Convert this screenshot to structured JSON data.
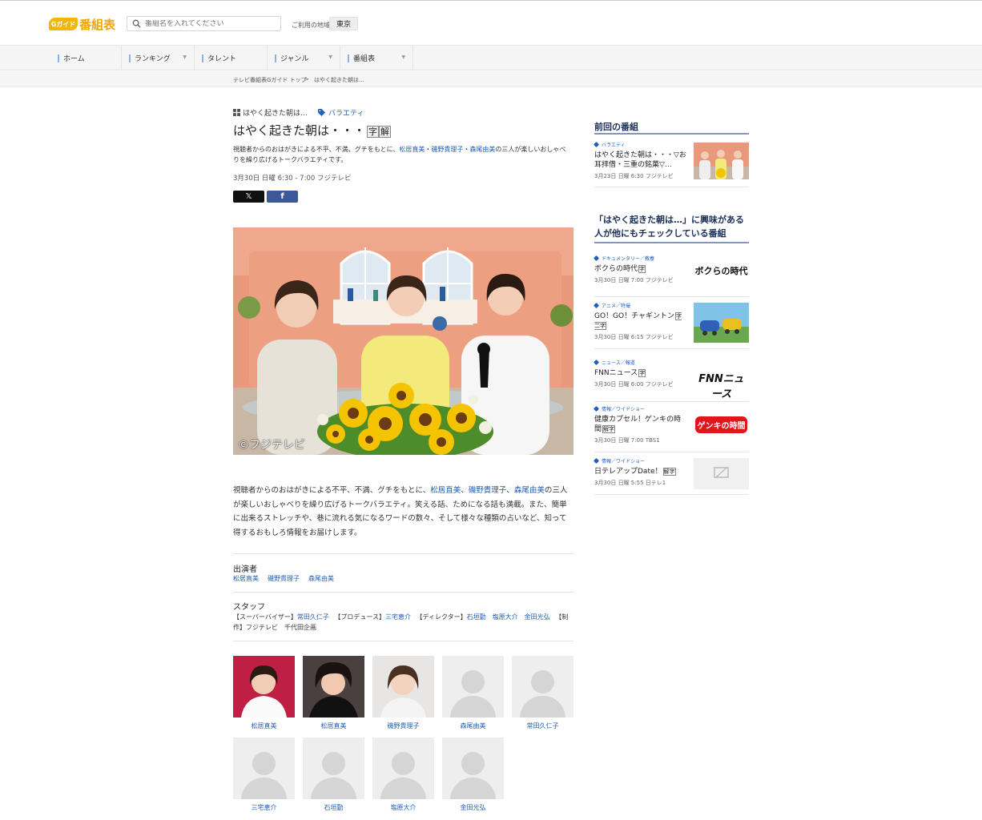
{
  "header": {
    "logo_mark": "Gガイド",
    "logo_text": "番組表",
    "search_placeholder": "番組名を入れてください",
    "region_label": "ご利用の地域",
    "region_value": "東京"
  },
  "nav": {
    "items": [
      {
        "label": "ホーム"
      },
      {
        "label": "ランキング"
      },
      {
        "label": "タレント"
      },
      {
        "label": "ジャンル"
      },
      {
        "label": "番組表"
      }
    ]
  },
  "breadcrumb": {
    "home": "テレビ番組表Gガイド トップ",
    "sep": ">",
    "current": "はやく起きた朝は…"
  },
  "program": {
    "series": "はやく起きた朝は…",
    "genre": "バラエティ",
    "title": "はやく起きた朝は・・・",
    "caption_badge": "字",
    "commentary_badge": "解",
    "summary_pre": "視聴者からのおはがきによる不平、不満、グチをもとに、",
    "summary_cast": [
      "松居直美",
      "磯野貴理子",
      "森尾由美"
    ],
    "summary_post": "の三人が楽しいおしゃべりを繰り広げるトークバラエティです。",
    "airtime": "3月30日 日曜 6:30  - 7:00 フジテレビ",
    "share_x": "𝕏",
    "share_fb": "f",
    "image_credit": "©フジテレビ",
    "desc_pre": "視聴者からのおはがきによる不平、不満、グチをもとに、",
    "desc_post": "の三人が楽しいおしゃべりを繰り広げるトークバラエティ。笑える話、ためになる話も満載。また、簡単に出来るストレッチや、巷に流れる気になるワードの数々、そして様々な種類の占いなど、知って得するおもしろ情報をお届けします。",
    "cast_heading": "出演者",
    "cast": [
      "松居直美",
      "磯野貴理子",
      "森尾由美"
    ],
    "staff_heading": "スタッフ",
    "staff": {
      "supervisor_label": "【スーパーバイザー】",
      "supervisor": "常田久仁子",
      "producer_label": "【プロデュース】",
      "producer": "三宅恵介",
      "director_label": "【ディレクター】",
      "directors": [
        "石垣勤",
        "塩原大介",
        "金田光弘"
      ],
      "production_label": "【制作】",
      "production": "フジテレビ　千代田企画"
    }
  },
  "people": [
    {
      "name": "松居直美",
      "photo": "photo-1"
    },
    {
      "name": "松居直美",
      "photo": "photo-2"
    },
    {
      "name": "磯野貴理子",
      "photo": "photo-3"
    },
    {
      "name": "森尾由美",
      "photo": "placeholder"
    },
    {
      "name": "常田久仁子",
      "photo": "placeholder"
    },
    {
      "name": "三宅恵介",
      "photo": "placeholder"
    },
    {
      "name": "石垣勤",
      "photo": "placeholder"
    },
    {
      "name": "塩原大介",
      "photo": "placeholder"
    },
    {
      "name": "金田光弘",
      "photo": "placeholder"
    }
  ],
  "sidebar": {
    "previous_heading": "前回の番組",
    "previous": {
      "category": "バラエティ",
      "title": "はやく起きた朝は・・・▽お耳拝借・三重の銘菓▽…",
      "time": "3月23日 日曜 6:30 フジテレビ"
    },
    "related_heading": "「はやく起きた朝は…」に興味がある人が他にもチェックしている番組",
    "related": [
      {
        "category": "ドキュメンタリー／教養",
        "title": "ボクらの時代",
        "badges": "字",
        "time": "3月30日 日曜 7:00 フジテレビ",
        "thumb_text": "ボクらの時代"
      },
      {
        "category": "アニメ／特撮",
        "title": "GO！GO！チャギントン",
        "badges": "字二字",
        "time": "3月30日 日曜 6:15 フジテレビ",
        "thumb_text": ""
      },
      {
        "category": "ニュース／報道",
        "title": "FNNニュース",
        "badges": "字",
        "time": "3月30日 日曜 6:00 フジテレビ",
        "thumb_text": "FNNニュース"
      },
      {
        "category": "情報／ワイドショー",
        "title": "健康カプセル！ゲンキの時間",
        "badges": "解字",
        "time": "3月30日 日曜 7:00 TBS1",
        "thumb_text": "ゲンキの時間"
      },
      {
        "category": "情報／ワイドショー",
        "title": "日テレアップDate！",
        "badges": "解字",
        "time": "3月30日 日曜 5:55 日テレ1",
        "thumb_text": ""
      }
    ]
  }
}
